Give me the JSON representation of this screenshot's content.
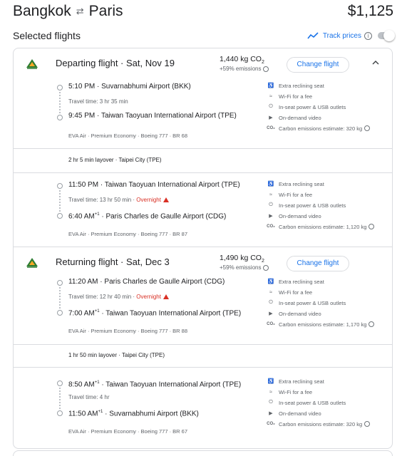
{
  "header": {
    "origin": "Bangkok",
    "destination": "Paris",
    "price": "$1,125"
  },
  "selected_title": "Selected flights",
  "track_prices": {
    "label": "Track prices",
    "enabled": false
  },
  "departing": {
    "title": "Departing flight · Sat, Nov 19",
    "co2_value": "1,440 kg CO",
    "co2_pct": "+59% emissions",
    "change_label": "Change flight",
    "segments": [
      {
        "dep_time": "5:10 PM",
        "dep_sup": "",
        "dep_airport": "Suvarnabhumi Airport (BKK)",
        "travel_time": "Travel time: 3 hr 35 min",
        "overnight": "",
        "arr_time": "9:45 PM",
        "arr_sup": "",
        "arr_airport": "Taiwan Taoyuan International Airport (TPE)",
        "info": "EVA Air · Premium Economy · Boeing 777 · BR 68",
        "carbon": "Carbon emissions estimate: 320 kg"
      },
      {
        "dep_time": "11:50 PM",
        "dep_sup": "",
        "dep_airport": "Taiwan Taoyuan International Airport (TPE)",
        "travel_time": "Travel time: 13 hr 50 min",
        "overnight": "Overnight",
        "arr_time": "6:40 AM",
        "arr_sup": "+1",
        "arr_airport": "Paris Charles de Gaulle Airport (CDG)",
        "info": "EVA Air · Premium Economy · Boeing 777 · BR 87",
        "carbon": "Carbon emissions estimate: 1,120 kg"
      }
    ],
    "layover": "2 hr 5 min layover · Taipei City (TPE)"
  },
  "returning": {
    "title": "Returning flight · Sat, Dec 3",
    "co2_value": "1,490 kg CO",
    "co2_pct": "+59% emissions",
    "change_label": "Change flight",
    "segments": [
      {
        "dep_time": "11:20 AM",
        "dep_sup": "",
        "dep_airport": "Paris Charles de Gaulle Airport (CDG)",
        "travel_time": "Travel time: 12 hr 40 min",
        "overnight": "Overnight",
        "arr_time": "7:00 AM",
        "arr_sup": "+1",
        "arr_airport": "Taiwan Taoyuan International Airport (TPE)",
        "info": "EVA Air · Premium Economy · Boeing 777 · BR 88",
        "carbon": "Carbon emissions estimate: 1,170 kg"
      },
      {
        "dep_time": "8:50 AM",
        "dep_sup": "+1",
        "dep_airport": "Taiwan Taoyuan International Airport (TPE)",
        "travel_time": "Travel time: 4 hr",
        "overnight": "",
        "arr_time": "11:50 AM",
        "arr_sup": "+1",
        "arr_airport": "Suvarnabhumi Airport (BKK)",
        "info": "EVA Air · Premium Economy · Boeing 777 · BR 67",
        "carbon": "Carbon emissions estimate: 320 kg"
      }
    ],
    "layover": "1 hr 50 min layover · Taipei City (TPE)"
  },
  "amenities": {
    "seat": "Extra reclining seat",
    "wifi": "Wi-Fi for a fee",
    "power": "In-seat power & USB outlets",
    "video": "On-demand video"
  },
  "colors": {
    "accent": "#1a73e8",
    "warning": "#d93025",
    "border": "#dadce0",
    "logo_green": "#2e7d32"
  },
  "icons": [
    "swap-arrows-icon",
    "trend-icon",
    "info-icon",
    "airline-logo-icon",
    "chevron-up-icon",
    "seat-icon",
    "wifi-icon",
    "power-icon",
    "video-icon",
    "co2-icon",
    "warning-icon"
  ]
}
